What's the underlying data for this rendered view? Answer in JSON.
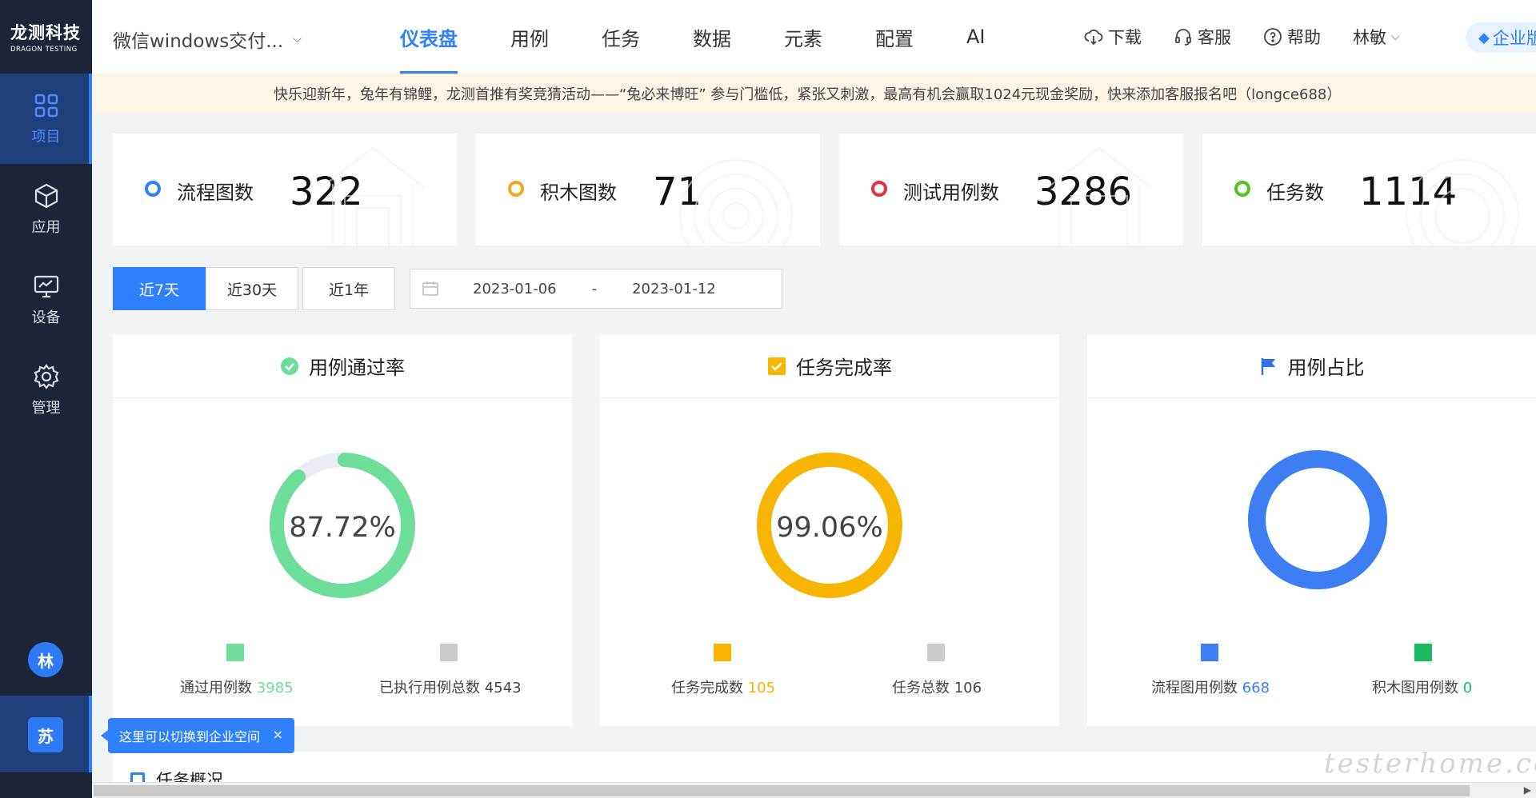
{
  "brand": {
    "name_cn": "龙测科技",
    "name_en": "DRAGON TESTING"
  },
  "sidebar": {
    "items": [
      {
        "label": "项目",
        "icon": "grid-icon",
        "active": true
      },
      {
        "label": "应用",
        "icon": "cube-icon",
        "active": false
      },
      {
        "label": "设备",
        "icon": "monitor-icon",
        "active": false
      },
      {
        "label": "管理",
        "icon": "gear-icon",
        "active": false
      }
    ],
    "user_avatar": "林",
    "space_avatar": "苏"
  },
  "topbar": {
    "project": "微信windows交付...",
    "menu": [
      "仪表盘",
      "用例",
      "任务",
      "数据",
      "元素",
      "配置",
      "AI"
    ],
    "active_menu": "仪表盘",
    "download": "下载",
    "service": "客服",
    "help": "帮助",
    "user": "林敏",
    "enterprise": "企业版"
  },
  "announcement": "快乐迎新年，兔年有锦鲤，龙测首推有奖竞猜活动——“兔必来博旺” 参与门槛低，紧张又刺激，最高有机会赢取1024元现金奖励，快来添加客服报名吧（longce688）",
  "stats": [
    {
      "label": "流程图数",
      "value": "322",
      "color": "#2f80ff"
    },
    {
      "label": "积木图数",
      "value": "71",
      "color": "#f5a623"
    },
    {
      "label": "测试用例数",
      "value": "3286",
      "color": "#e8303e"
    },
    {
      "label": "任务数",
      "value": "1114",
      "color": "#52c41a"
    }
  ],
  "range": {
    "buttons": [
      "近7天",
      "近30天",
      "近1年"
    ],
    "active": "近7天",
    "start": "2023-01-06",
    "sep": "-",
    "end": "2023-01-12"
  },
  "charts": [
    {
      "title": "用例通过率",
      "icon": "check-circle-icon",
      "center": "87.72%",
      "percent": 87.72,
      "color": "#6ddd9a",
      "track": "#e9ecf3",
      "legend": [
        {
          "label": "通过用例数",
          "value": "3985",
          "color": "#6ddd9a",
          "value_color": "#6ddd9a"
        },
        {
          "label": "已执行用例总数",
          "value": "4543",
          "color": "#cccccc",
          "value_color": "#333333"
        }
      ]
    },
    {
      "title": "任务完成率",
      "icon": "check-square-icon",
      "center": "99.06%",
      "percent": 99.06,
      "color": "#f7b500",
      "track": "#e9ecf3",
      "legend": [
        {
          "label": "任务完成数",
          "value": "105",
          "color": "#f7b500",
          "value_color": "#f7b500"
        },
        {
          "label": "任务总数",
          "value": "106",
          "color": "#cccccc",
          "value_color": "#333333"
        }
      ]
    },
    {
      "title": "用例占比",
      "icon": "flag-icon",
      "center": "",
      "percent": 100,
      "color": "#3d7ef5",
      "track": "#1dbb5e",
      "legend": [
        {
          "label": "流程图用例数",
          "value": "668",
          "color": "#3d7ef5",
          "value_color": "#3d7ef5"
        },
        {
          "label": "积木图用例数",
          "value": "0",
          "color": "#1dbb5e",
          "value_color": "#1dbb5e"
        }
      ]
    }
  ],
  "task_section": {
    "title": "任务概况"
  },
  "tooltip": {
    "text": "这里可以切换到企业空间",
    "close": "×"
  },
  "watermark": "testerhome.com"
}
